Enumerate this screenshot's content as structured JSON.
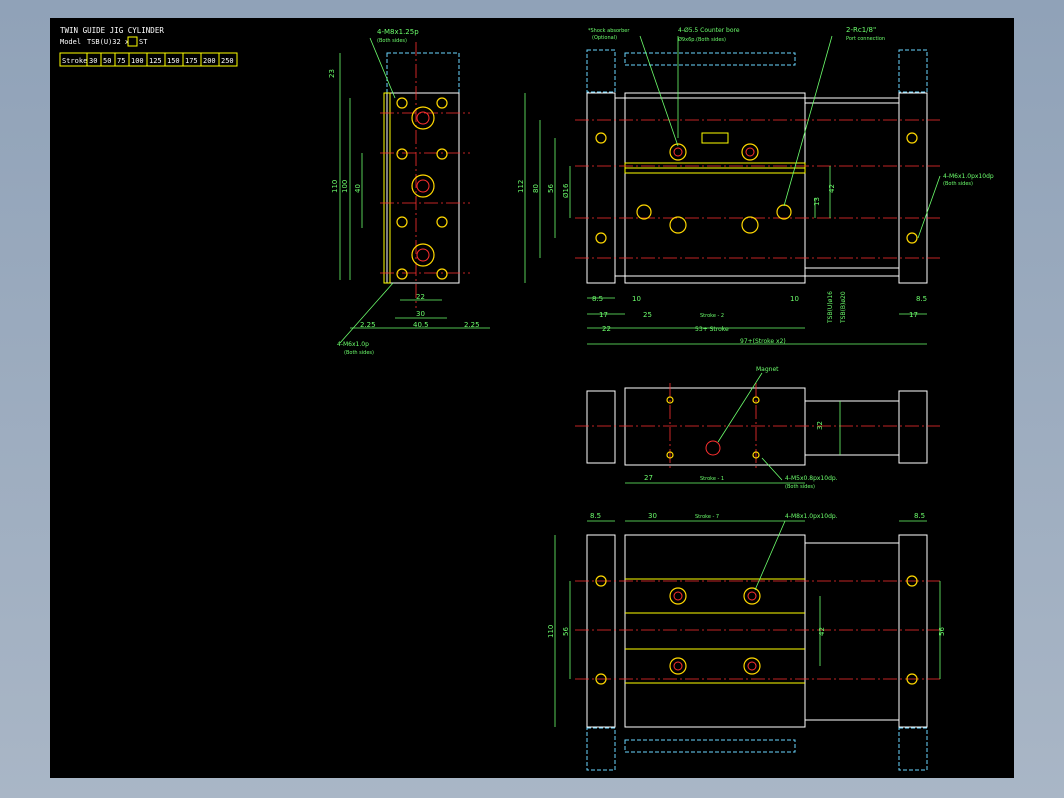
{
  "title_block": {
    "title": "TWIN GUIDE JIG CYLINDER",
    "model_label": "Model",
    "model_value": "TSB(U)32 x",
    "model_suffix": "ST",
    "stroke_header": "Stroke",
    "strokes": [
      "30",
      "50",
      "75",
      "100",
      "125",
      "150",
      "175",
      "200",
      "250"
    ]
  },
  "left_view": {
    "notes": {
      "tap_top": "4-M8x1.25p",
      "tap_top_sub": "(Both sides)",
      "tap_bottom": "4-M6x1.0p",
      "tap_bottom_sub": "(Both sides)"
    },
    "dims": {
      "d23": "23",
      "d110": "110",
      "d100": "100",
      "d40": "40",
      "d22": "22",
      "d30": "30",
      "d225a": "2.25",
      "d405": "40.5",
      "d225b": "2.25"
    }
  },
  "front_view": {
    "notes": {
      "shock": "*Shock absorber",
      "shock_sub": "(Optional)",
      "counter": "4-Ø5.5 Counter bore",
      "counter_sub": "Ø9x6p.(Both sides)",
      "port": "2-Rc1/8\"",
      "port_sub": "Port connection",
      "tap_right": "4-M6x1.0px10dp",
      "tap_right_sub": "(Both sides)"
    },
    "dims": {
      "d112": "112",
      "d80": "80",
      "d56": "56",
      "d16": "Ø16",
      "d42": "42",
      "d13": "13",
      "d85a": "8.5",
      "d17a": "17",
      "d10a": "10",
      "d25": "25",
      "stroke2": "Stroke - 2",
      "d10b": "10",
      "d85b": "8.5",
      "d17b": "17",
      "d22": "22",
      "d53": "53+ Stroke",
      "d97": "97+(Stroke x2)",
      "tsb_u": "TSB(U)ø16",
      "tsb": "TSB(B)ø20"
    }
  },
  "side_view": {
    "notes": {
      "magnet": "Magnet",
      "tap": "4-M5x0.8px10dp.",
      "tap_sub": "(Both sides)"
    },
    "dims": {
      "d32": "32",
      "d27": "27",
      "stroke1": "Stroke - 1"
    }
  },
  "bottom_view": {
    "notes": {
      "tap": "4-M8x1.0px10dp."
    },
    "dims": {
      "d85a": "8.5",
      "d30": "30",
      "stroke7": "Stroke - 7",
      "d85b": "8.5",
      "d110": "110",
      "d56a": "56",
      "d42": "42",
      "d56b": "56"
    }
  },
  "colors": {
    "background": "#000000",
    "outline": "#ffffff",
    "hidden": "#6ad6ff",
    "dimension": "#6cff6c",
    "center": "#ff3030",
    "highlight": "#ffff00"
  }
}
